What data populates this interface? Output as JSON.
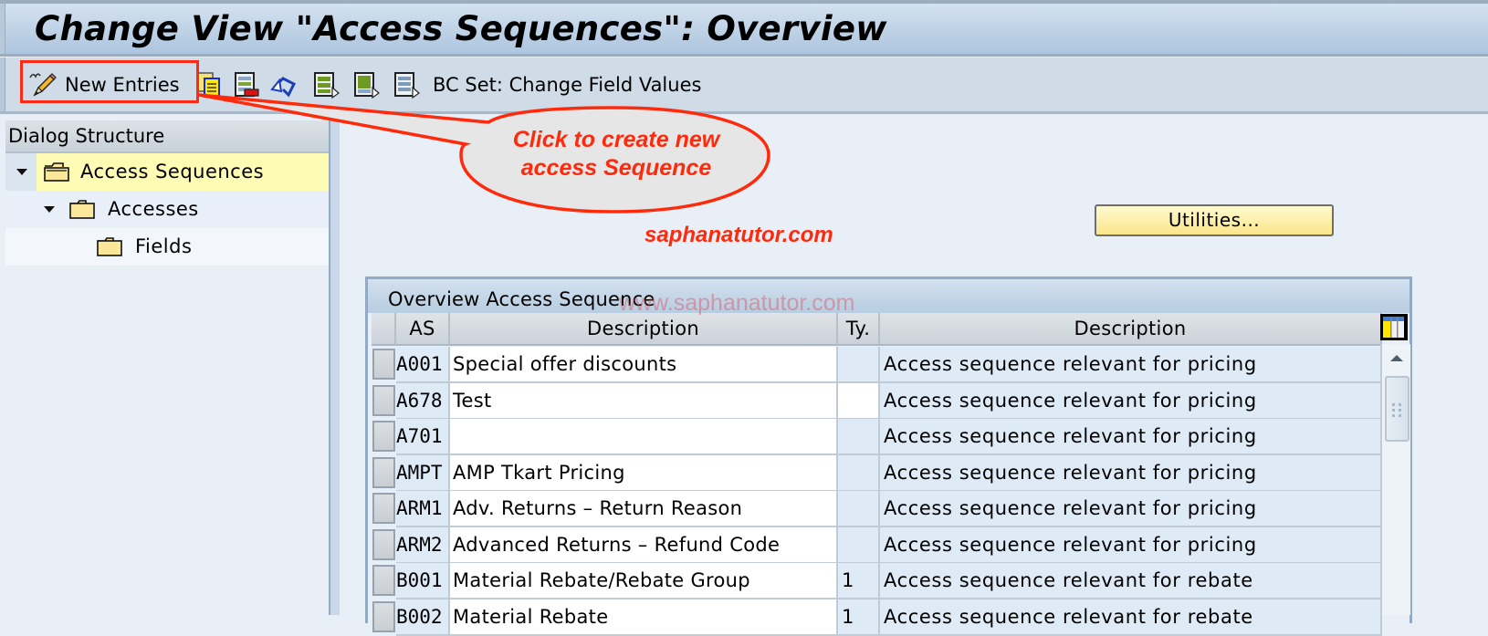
{
  "window": {
    "title": "Change View \"Access Sequences\": Overview"
  },
  "toolbar": {
    "new_entries_label": "New Entries",
    "bc_set_label": "BC Set: Change Field Values",
    "icons": [
      "pencil-new-entries-icon",
      "copy-as-icon",
      "delete-icon",
      "undo-change-icon",
      "select-all-icon",
      "select-block-icon",
      "deselect-all-icon"
    ]
  },
  "dialog_structure": {
    "header": "Dialog Structure",
    "items": [
      {
        "label": "Access Sequences",
        "level": 0,
        "expanded": true,
        "selected": true,
        "icon": "folder-open-icon"
      },
      {
        "label": "Accesses",
        "level": 1,
        "expanded": true,
        "selected": false,
        "icon": "folder-icon"
      },
      {
        "label": "Fields",
        "level": 2,
        "expanded": false,
        "selected": false,
        "icon": "folder-icon"
      }
    ]
  },
  "annotation": {
    "callout_text_line1": "Click to create new",
    "callout_text_line2": "access Sequence",
    "watermark": "saphanatutor.com",
    "watermark_url": "www.saphanatutor.com",
    "color": "#ff2a0c"
  },
  "utilities_button": "Utilities...",
  "table": {
    "title": "Overview Access Sequence",
    "columns": [
      "AS",
      "Description",
      "Ty.",
      "Description"
    ],
    "rows": [
      {
        "as": "A001",
        "description": "Special offer discounts",
        "type": "",
        "type_description": "Access sequence relevant for pricing",
        "type_editable": false
      },
      {
        "as": "A678",
        "description": "Test",
        "type": "",
        "type_description": "Access sequence relevant for pricing",
        "type_editable": true
      },
      {
        "as": "A701",
        "description": "",
        "type": "",
        "type_description": "Access sequence relevant for pricing",
        "type_editable": false
      },
      {
        "as": "AMPT",
        "description": "AMP Tkart Pricing",
        "type": "",
        "type_description": "Access sequence relevant for pricing",
        "type_editable": false
      },
      {
        "as": "ARM1",
        "description": "Adv. Returns – Return Reason",
        "type": "",
        "type_description": "Access sequence relevant for pricing",
        "type_editable": false
      },
      {
        "as": "ARM2",
        "description": "Advanced Returns – Refund Code",
        "type": "",
        "type_description": "Access sequence relevant for pricing",
        "type_editable": false
      },
      {
        "as": "B001",
        "description": "Material Rebate/Rebate Group",
        "type": "1",
        "type_description": "Access sequence relevant for rebate",
        "type_editable": false
      },
      {
        "as": "B002",
        "description": "Material Rebate",
        "type": "1",
        "type_description": "Access sequence relevant for rebate",
        "type_editable": false
      }
    ]
  }
}
